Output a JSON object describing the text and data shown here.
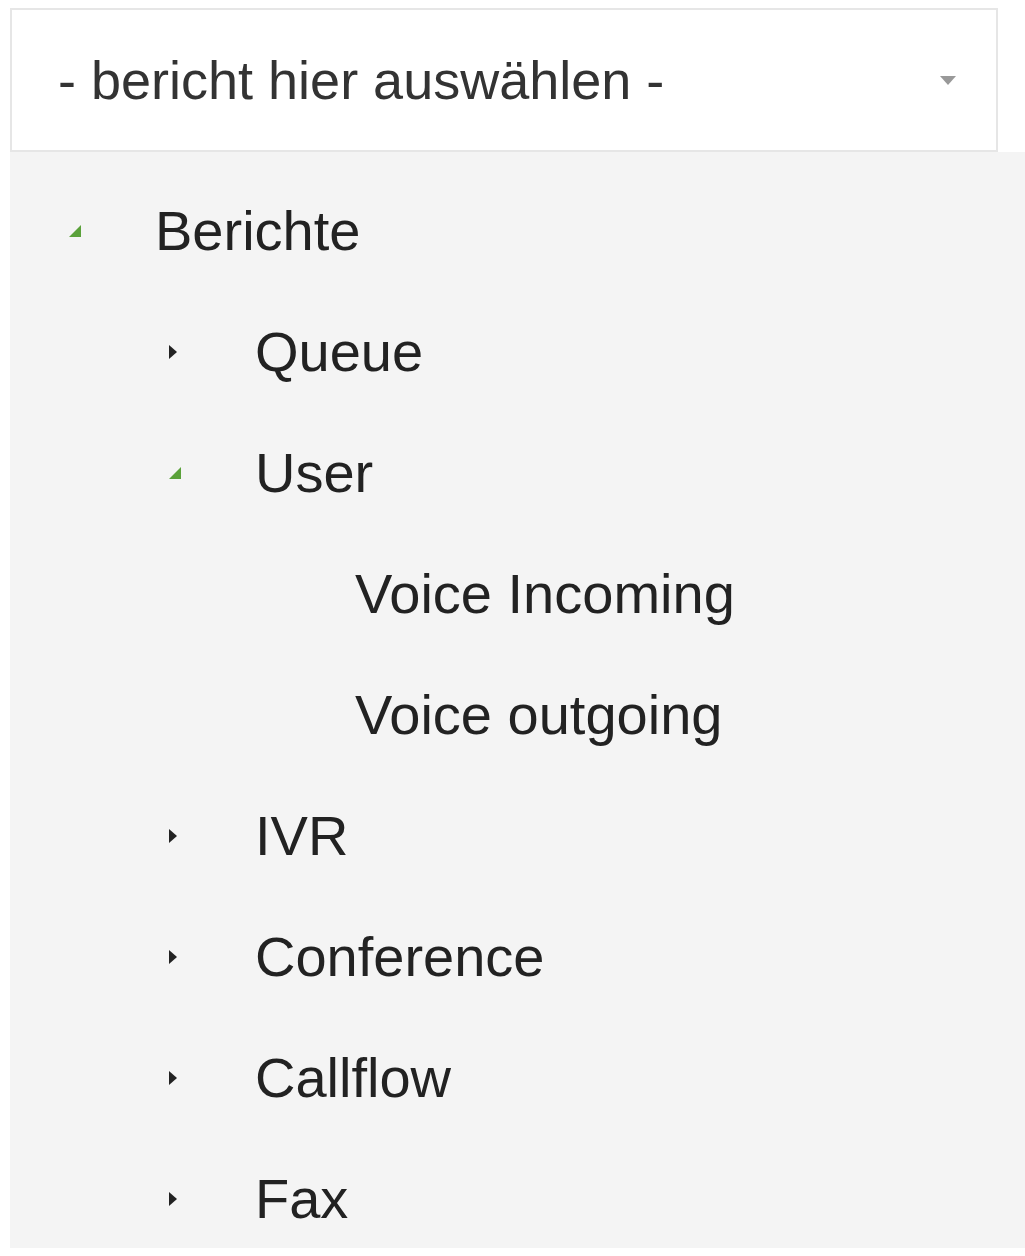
{
  "select": {
    "placeholder": "- bericht hier auswählen -"
  },
  "tree": [
    {
      "label": "Berichte",
      "expanded": true,
      "children": [
        {
          "label": "Queue",
          "expanded": false
        },
        {
          "label": "User",
          "expanded": true,
          "children": [
            {
              "label": "Voice Incoming"
            },
            {
              "label": "Voice outgoing"
            }
          ]
        },
        {
          "label": "IVR",
          "expanded": false
        },
        {
          "label": "Conference",
          "expanded": false
        },
        {
          "label": "Callflow",
          "expanded": false
        },
        {
          "label": "Fax",
          "expanded": false
        }
      ]
    }
  ]
}
